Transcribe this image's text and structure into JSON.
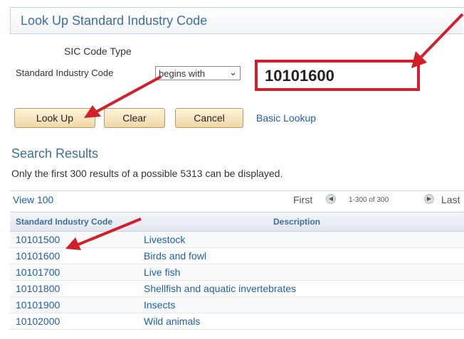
{
  "page": {
    "title": "Look Up Standard Industry Code"
  },
  "form": {
    "sic_type_label": "SIC Code Type",
    "code_label": "Standard Industry Code",
    "operator_value": "begins with",
    "code_value": "10101600"
  },
  "buttons": {
    "lookup": "Look Up",
    "clear": "Clear",
    "cancel": "Cancel",
    "basic_lookup": "Basic Lookup"
  },
  "results": {
    "heading": "Search Results",
    "note": "Only the first 300 results of a possible 5313 can be displayed.",
    "view_link": "View 100",
    "first_label": "First",
    "range": "1-300 of 300",
    "last_label": "Last",
    "columns": {
      "code": "Standard Industry Code",
      "description": "Description"
    },
    "rows": [
      {
        "code": "10101500",
        "description": "Livestock"
      },
      {
        "code": "10101600",
        "description": "Birds and fowl"
      },
      {
        "code": "10101700",
        "description": "Live fish"
      },
      {
        "code": "10101800",
        "description": "Shellfish and aquatic invertebrates"
      },
      {
        "code": "10101900",
        "description": "Insects"
      },
      {
        "code": "10102000",
        "description": "Wild animals"
      }
    ]
  },
  "icons": {
    "prev": "circle-left-arrow-icon",
    "next": "circle-right-arrow-icon",
    "chevron": "chevron-down-icon"
  },
  "colors": {
    "annotation_red": "#d2202a",
    "link_blue": "#1f5fa8",
    "heading_blue": "#3f6e9a",
    "button_tan": "#f0d8a8"
  }
}
